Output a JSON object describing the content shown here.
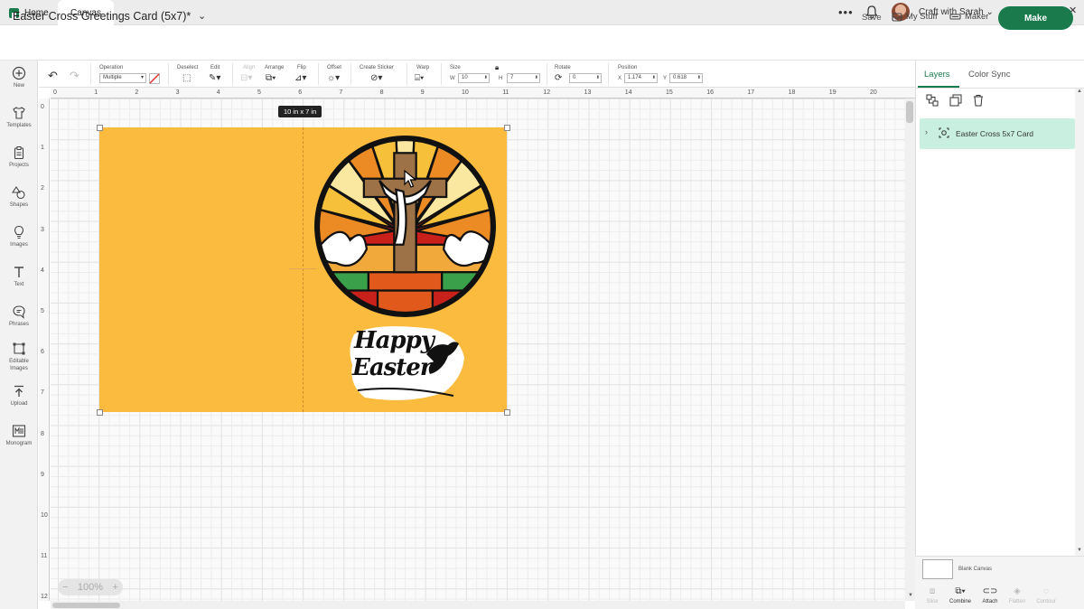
{
  "tabs": {
    "home": "Home",
    "canvas": "Canvas"
  },
  "topbar": {
    "account": "Craft with Sarah",
    "menu": "•••",
    "win_min": "—",
    "win_max": "▢",
    "win_close": "✕"
  },
  "header": {
    "title": "Easter Cross Greetings Card (5x7)*",
    "save": "Save",
    "my_stuff": "My Stuff",
    "maker": "Maker",
    "make": "Make"
  },
  "sidebar": [
    {
      "label": "New",
      "icon": "plus-circle-icon"
    },
    {
      "label": "Templates",
      "icon": "shirt-icon"
    },
    {
      "label": "Projects",
      "icon": "clipboard-icon"
    },
    {
      "label": "Shapes",
      "icon": "shapes-icon"
    },
    {
      "label": "Images",
      "icon": "lightbulb-icon"
    },
    {
      "label": "Text",
      "icon": "text-icon"
    },
    {
      "label": "Phrases",
      "icon": "speech-bubble-icon"
    },
    {
      "label": "Editable Images",
      "line1": "Editable",
      "line2": "Images",
      "icon": "node-edit-icon"
    },
    {
      "label": "Upload",
      "icon": "upload-icon"
    },
    {
      "label": "Monogram",
      "icon": "monogram-icon"
    }
  ],
  "toolbar": {
    "operation_label": "Operation",
    "operation_value": "Multiple",
    "deselect": "Deselect",
    "edit": "Edit",
    "align": "Align",
    "arrange": "Arrange",
    "flip": "Flip",
    "offset": "Offset",
    "create_sticker": "Create Sticker",
    "warp": "Warp",
    "size": "Size",
    "w_label": "W",
    "w_value": "10",
    "h_label": "H",
    "h_value": "7",
    "rotate": "Rotate",
    "rotate_value": "0",
    "position": "Position",
    "x_label": "X",
    "x_value": "1.174",
    "y_label": "Y",
    "y_value": "0.618"
  },
  "rulers": {
    "h": [
      "0",
      "1",
      "2",
      "3",
      "4",
      "5",
      "6",
      "7",
      "8",
      "9",
      "10",
      "11",
      "12",
      "13",
      "14",
      "15",
      "16",
      "17",
      "18",
      "19",
      "20"
    ],
    "v": [
      "0",
      "1",
      "2",
      "3",
      "4",
      "5",
      "6",
      "7",
      "8",
      "9",
      "10",
      "11",
      "12"
    ]
  },
  "canvas": {
    "size_tag": "10 in x 7 in",
    "zoom": "100%",
    "zoom_minus": "−",
    "zoom_plus": "+",
    "card_color": "#fbbb3f",
    "greeting_line1": "Happy",
    "greeting_line2": "Easter"
  },
  "right_panel": {
    "tab_layers": "Layers",
    "tab_color_sync": "Color Sync",
    "layer_name": "Easter Cross 5x7 Card",
    "blank_canvas": "Blank Canvas",
    "bottom_tools": [
      {
        "label": "Slice",
        "enabled": false
      },
      {
        "label": "Combine",
        "enabled": true
      },
      {
        "label": "Attach",
        "enabled": true
      },
      {
        "label": "Flatten",
        "enabled": false
      },
      {
        "label": "Contour",
        "enabled": false
      }
    ]
  },
  "colors": {
    "accent": "#1b7a4c",
    "layer_highlight": "#c9efe1"
  }
}
